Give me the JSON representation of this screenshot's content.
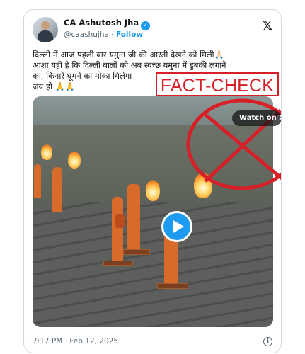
{
  "tweet": {
    "author_name": "CA Ashutosh Jha",
    "handle": "@caashujha",
    "separator": " · ",
    "follow_label": "Follow",
    "text_lines": [
      "दिल्ली में आज पहली बार यमुना जी की आरती देखने को मिली🙏🏻",
      "आशा यही है कि दिल्ली वालों को अब स्वच्छ यमुना में डुबकी लगाने",
      "का, किनारे घूमने का मोका मिलेगा",
      "जय हो 🙏🙏"
    ],
    "timestamp": "7:17 PM · Feb 12, 2025"
  },
  "overlay": {
    "fact_check_label": "FACT-CHECK",
    "watch_label": "Watch on X",
    "accent_red": "#d61f26"
  },
  "icons": {
    "verified": "verified-badge-icon",
    "x_logo": "x-logo-icon",
    "play": "play-icon",
    "info": "info-icon"
  },
  "colors": {
    "link_blue": "#1d9bf0",
    "text": "#0f1419",
    "muted": "#536471"
  }
}
